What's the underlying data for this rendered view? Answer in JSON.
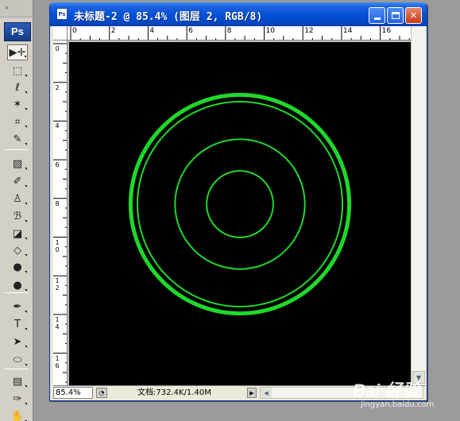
{
  "tools_panel": {
    "logo": "Ps",
    "grip": "»",
    "tools": [
      {
        "name": "move-tool",
        "glyph": "▶✛",
        "active": true
      },
      {
        "name": "marquee-tool",
        "glyph": "⬚"
      },
      {
        "name": "lasso-tool",
        "glyph": "ℓ"
      },
      {
        "name": "magic-wand-tool",
        "glyph": "✶"
      },
      {
        "name": "crop-tool",
        "glyph": "⌗"
      },
      {
        "name": "slice-tool",
        "glyph": "✎"
      },
      {
        "name": "healing-brush-tool",
        "glyph": "▨"
      },
      {
        "name": "brush-tool",
        "glyph": "✐"
      },
      {
        "name": "clone-stamp-tool",
        "glyph": "♙"
      },
      {
        "name": "history-brush-tool",
        "glyph": "ℬ"
      },
      {
        "name": "eraser-tool",
        "glyph": "◪"
      },
      {
        "name": "paint-bucket-tool",
        "glyph": "◇"
      },
      {
        "name": "blur-tool",
        "glyph": "●"
      },
      {
        "name": "dodge-tool",
        "glyph": "●"
      },
      {
        "name": "pen-tool",
        "glyph": "✒"
      },
      {
        "name": "type-tool",
        "glyph": "T"
      },
      {
        "name": "path-selection-tool",
        "glyph": "➤"
      },
      {
        "name": "ellipse-tool",
        "glyph": "⬭"
      },
      {
        "name": "notes-tool",
        "glyph": "▤"
      },
      {
        "name": "eyedropper-tool",
        "glyph": "✑"
      },
      {
        "name": "hand-tool",
        "glyph": "✋"
      }
    ]
  },
  "document": {
    "title": "未标题-2 @ 85.4% (图层 2, RGB/8)",
    "title_icon": "Ps",
    "buttons": {
      "minimize": "_",
      "maximize": "□",
      "close": "✕"
    },
    "ruler_h_labels": [
      "0",
      "2",
      "4",
      "6",
      "8",
      "10",
      "12",
      "14",
      "16"
    ],
    "ruler_v_labels": [
      "0",
      "2",
      "4",
      "6",
      "8",
      "10",
      "12",
      "14",
      "16"
    ],
    "canvas": {
      "background": "#000000",
      "stroke_color": "#1fd82a",
      "circles": [
        {
          "radius_fraction": 0.64,
          "thickness": "thick"
        },
        {
          "radius_fraction": 0.6,
          "thickness": "thin"
        },
        {
          "radius_fraction": 0.38,
          "thickness": "thin"
        },
        {
          "radius_fraction": 0.195,
          "thickness": "thin"
        }
      ]
    },
    "status": {
      "zoom": "85.4%",
      "doc_info": "文档:732.4K/1.40M",
      "arrow": "▶"
    }
  },
  "watermark": {
    "logo": "Bai 经验",
    "url": "jingyan.baidu.com"
  }
}
